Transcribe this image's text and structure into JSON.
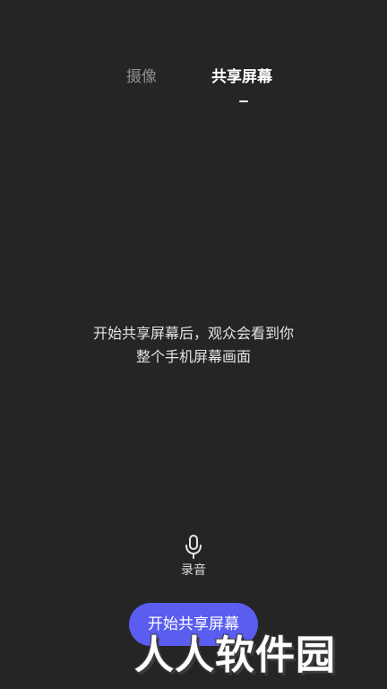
{
  "tabs": [
    {
      "label": "摄像",
      "active": false
    },
    {
      "label": "共享屏幕",
      "active": true
    }
  ],
  "message": {
    "line1": "开始共享屏幕后，观众会看到你",
    "line2": "整个手机屏幕画面"
  },
  "mic": {
    "icon": "microphone-icon",
    "label": "录音"
  },
  "start_button": {
    "label": "开始共享屏幕",
    "color": "#5a5df0"
  },
  "watermark": {
    "text": "人人软件园"
  },
  "colors": {
    "background": "#252526",
    "active_tab": "#ffffff",
    "inactive_tab": "#8d8d8f"
  }
}
